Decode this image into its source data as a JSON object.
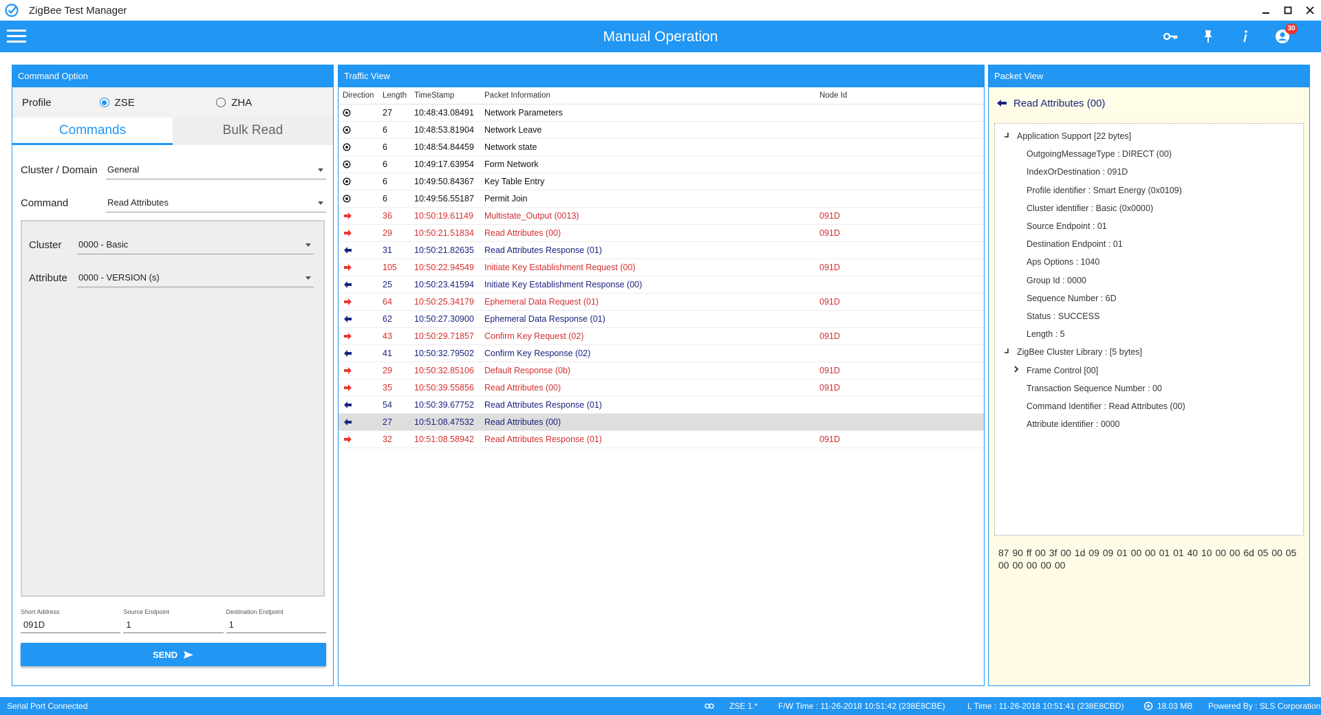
{
  "window": {
    "title": "ZigBee Test Manager"
  },
  "appbar": {
    "title": "Manual Operation",
    "notification_count": "30"
  },
  "command_option": {
    "header": "Command Option",
    "profile_label": "Profile",
    "profiles": [
      {
        "label": "ZSE",
        "selected": true
      },
      {
        "label": "ZHA",
        "selected": false
      }
    ],
    "tabs": [
      {
        "label": "Commands",
        "active": true
      },
      {
        "label": "Bulk Read",
        "active": false
      }
    ],
    "cluster_domain_label": "Cluster / Domain",
    "cluster_domain_value": "General",
    "command_label": "Command",
    "command_value": "Read Attributes",
    "cluster_label": "Cluster",
    "cluster_value": "0000 - Basic",
    "attribute_label": "Attribute",
    "attribute_value": "0000 - VERSION (s)",
    "short_address_label": "Short Address",
    "short_address_value": "091D",
    "source_endpoint_label": "Source Endpoint",
    "source_endpoint_value": "1",
    "destination_endpoint_label": "Destination Endpoint",
    "destination_endpoint_value": "1",
    "send_label": "SEND"
  },
  "traffic": {
    "header": "Traffic View",
    "columns": [
      "Direction",
      "Length",
      "TimeStamp",
      "Packet Information",
      "Node Id"
    ],
    "rows": [
      {
        "dir": "sys",
        "length": "27",
        "timestamp": "10:48:43.08491",
        "info": "Network Parameters",
        "node": ""
      },
      {
        "dir": "sys",
        "length": "6",
        "timestamp": "10:48:53.81904",
        "info": "Network Leave",
        "node": ""
      },
      {
        "dir": "sys",
        "length": "6",
        "timestamp": "10:48:54.84459",
        "info": "Network state",
        "node": ""
      },
      {
        "dir": "sys",
        "length": "6",
        "timestamp": "10:49:17.63954",
        "info": "Form Network",
        "node": ""
      },
      {
        "dir": "sys",
        "length": "6",
        "timestamp": "10:49:50.84367",
        "info": "Key Table Entry",
        "node": ""
      },
      {
        "dir": "sys",
        "length": "6",
        "timestamp": "10:49:56.55187",
        "info": "Permit Join",
        "node": ""
      },
      {
        "dir": "out",
        "length": "36",
        "timestamp": "10:50:19.61149",
        "info": "Multistate_Output (0013)",
        "node": "091D"
      },
      {
        "dir": "out",
        "length": "29",
        "timestamp": "10:50:21.51834",
        "info": "Read Attributes (00)",
        "node": "091D"
      },
      {
        "dir": "in",
        "length": "31",
        "timestamp": "10:50:21.82635",
        "info": "Read Attributes Response (01)",
        "node": ""
      },
      {
        "dir": "out",
        "length": "105",
        "timestamp": "10:50:22.94549",
        "info": "Initiate Key Establishment Request (00)",
        "node": "091D"
      },
      {
        "dir": "in",
        "length": "25",
        "timestamp": "10:50:23.41594",
        "info": "Initiate Key Establishment Response (00)",
        "node": ""
      },
      {
        "dir": "out",
        "length": "64",
        "timestamp": "10:50:25.34179",
        "info": "Ephemeral Data Request (01)",
        "node": "091D"
      },
      {
        "dir": "in",
        "length": "62",
        "timestamp": "10:50:27.30900",
        "info": "Ephemeral Data Response (01)",
        "node": ""
      },
      {
        "dir": "out",
        "length": "43",
        "timestamp": "10:50:29.71857",
        "info": "Confirm Key Request (02)",
        "node": "091D"
      },
      {
        "dir": "in",
        "length": "41",
        "timestamp": "10:50:32.79502",
        "info": "Confirm Key Response (02)",
        "node": ""
      },
      {
        "dir": "out",
        "length": "29",
        "timestamp": "10:50:32.85106",
        "info": "Default Response (0b)",
        "node": "091D"
      },
      {
        "dir": "out",
        "length": "35",
        "timestamp": "10:50:39.55856",
        "info": "Read Attributes (00)",
        "node": "091D"
      },
      {
        "dir": "in",
        "length": "54",
        "timestamp": "10:50:39.67752",
        "info": "Read Attributes Response (01)",
        "node": ""
      },
      {
        "dir": "in",
        "length": "27",
        "timestamp": "10:51:08.47532",
        "info": "Read Attributes (00)",
        "node": "",
        "selected": true
      },
      {
        "dir": "out",
        "length": "32",
        "timestamp": "10:51:08.58942",
        "info": "Read Attributes Response (01)",
        "node": "091D"
      }
    ]
  },
  "packet": {
    "header": "Packet View",
    "title": "Read Attributes (00)",
    "tree": [
      {
        "level": 0,
        "toggle": "collapse",
        "label": "Application Support [22 bytes]"
      },
      {
        "level": 1,
        "label": "OutgoingMessageType : DIRECT (00)"
      },
      {
        "level": 1,
        "label": "IndexOrDestination : 091D"
      },
      {
        "level": 1,
        "label": "Profile identifier : Smart Energy (0x0109)"
      },
      {
        "level": 1,
        "label": "Cluster identifier : Basic (0x0000)"
      },
      {
        "level": 1,
        "label": "Source Endpoint : 01"
      },
      {
        "level": 1,
        "label": "Destination Endpoint : 01"
      },
      {
        "level": 1,
        "label": "Aps Options : 1040"
      },
      {
        "level": 1,
        "label": "Group Id : 0000"
      },
      {
        "level": 1,
        "label": "Sequence Number : 6D"
      },
      {
        "level": 1,
        "label": "Status : SUCCESS"
      },
      {
        "level": 1,
        "label": "Length : 5"
      },
      {
        "level": 0,
        "toggle": "collapse",
        "label": "ZigBee Cluster Library : [5 bytes]"
      },
      {
        "level": 1,
        "toggle": "expand",
        "label": "Frame Control [00]"
      },
      {
        "level": 1,
        "label": "Transaction Sequence Number : 00"
      },
      {
        "level": 1,
        "label": "Command Identifier : Read Attributes (00)"
      },
      {
        "level": 1,
        "label": "Attribute identifier : 0000"
      }
    ],
    "hex": "87 90 ff 00 3f 00 1d 09 09 01 00 00 01 01 40 10 00 00 6d 05 00 05 00 00 00 00 00"
  },
  "status": {
    "connection": "Serial Port Connected",
    "version": "ZSE 1.*",
    "fw_time": "F/W Time : 11-26-2018 10:51:42 (238E8CBE)",
    "l_time": "L Time : 11-26-2018 10:51:41 (238E8CBD)",
    "memory": "18.03 MB",
    "powered_by": "Powered By : SLS Corporation"
  },
  "colors": {
    "accent": "#2196f3",
    "outgoing": "#d32f2f",
    "incoming": "#1a237e"
  }
}
